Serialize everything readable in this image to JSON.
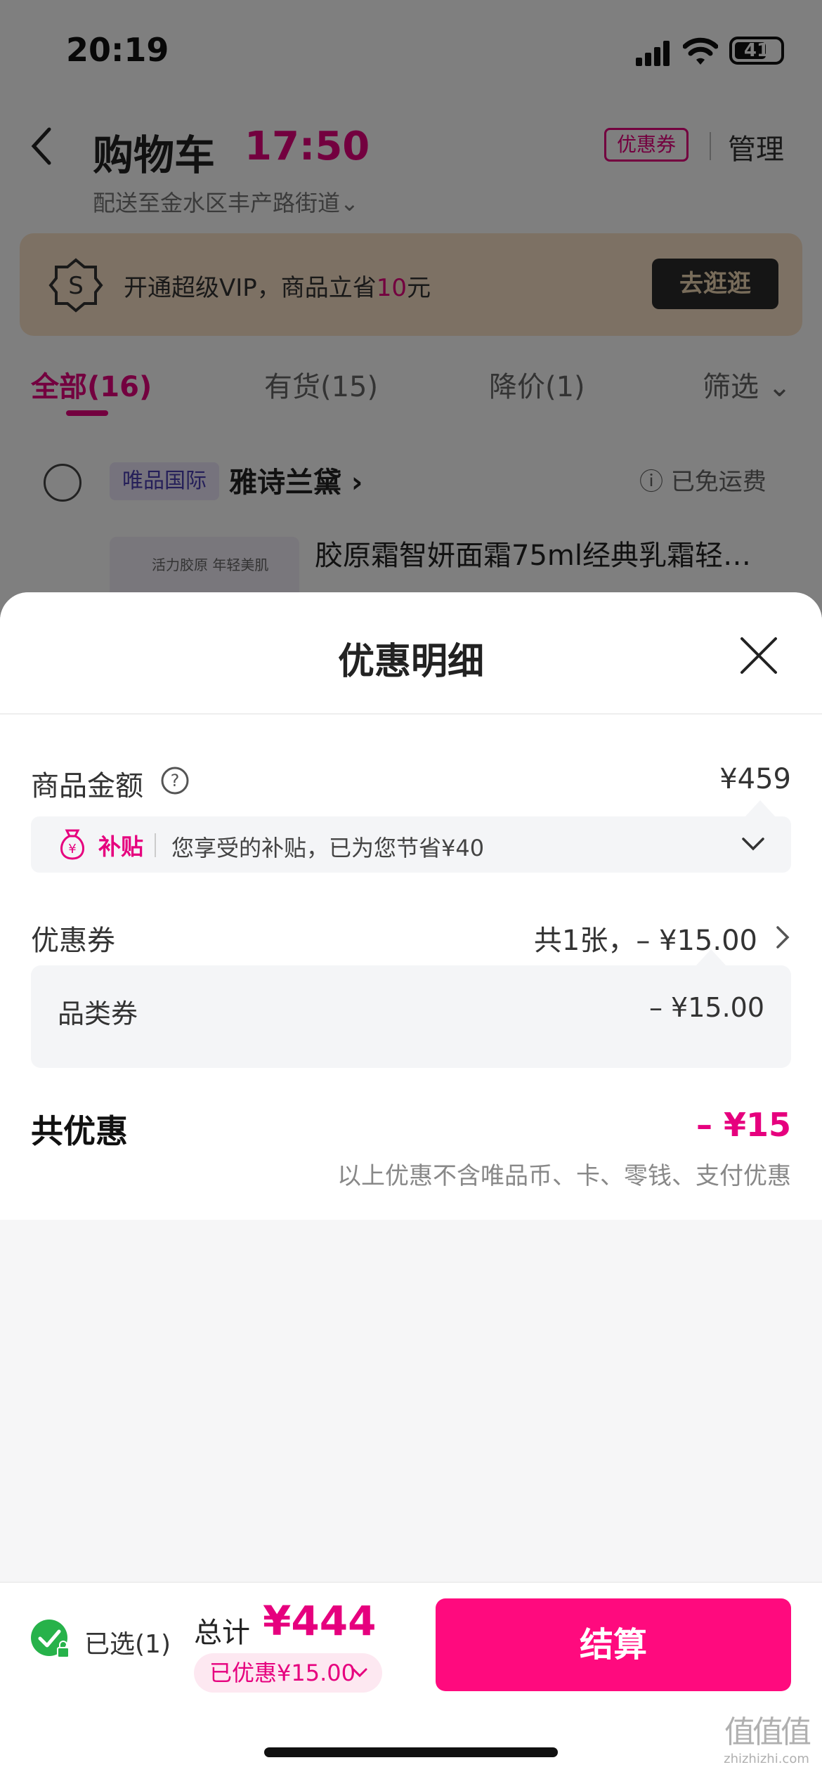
{
  "status_bar": {
    "time": "20:19",
    "battery": "41"
  },
  "cart": {
    "title": "购物车",
    "timer": "17:50",
    "coupon_tag": "优惠券",
    "manage": "管理",
    "delivery": "配送至金水区丰产路街道⌄",
    "vip": {
      "text_before": "开通超级VIP，商品立省",
      "amount": "10",
      "text_after": "元",
      "button": "去逛逛"
    },
    "tabs": [
      {
        "label": "全部(16)",
        "active": true
      },
      {
        "label": "有货(15)",
        "active": false
      },
      {
        "label": "降价(1)",
        "active": false
      },
      {
        "label": "筛选",
        "active": false
      }
    ],
    "store": {
      "badge": "唯品国际",
      "name": "雅诗兰黛",
      "shipping": "已免运费",
      "product_title": "胶原霜智妍面霜75ml经典乳霜轻…",
      "product_thumb_text": "活力胶原 年轻美肌"
    }
  },
  "sheet": {
    "title": "优惠明细",
    "goods_amount": {
      "label": "商品金额",
      "value": "¥459"
    },
    "subsidy": {
      "tag": "补贴",
      "text": "您享受的补贴，已为您节省¥40"
    },
    "coupons": {
      "label": "优惠券",
      "summary": "共1张，– ¥15.00",
      "items": [
        {
          "label": "品类券",
          "value": "– ¥15.00"
        }
      ]
    },
    "total_discount": {
      "label": "共优惠",
      "value": "– ¥15",
      "note": "以上优惠不含唯品币、卡、零钱、支付优惠"
    }
  },
  "checkout": {
    "selected": "已选(1)",
    "total_label": "总计",
    "total_value": "¥444",
    "saved": "已优惠¥15.00",
    "pay_button": "结算"
  },
  "watermark": {
    "logo": "值值值",
    "url": "zhizhizhi.com"
  },
  "colors": {
    "accent": "#e6007e",
    "pay_button": "#ff0a7e",
    "check": "#27b24a"
  }
}
